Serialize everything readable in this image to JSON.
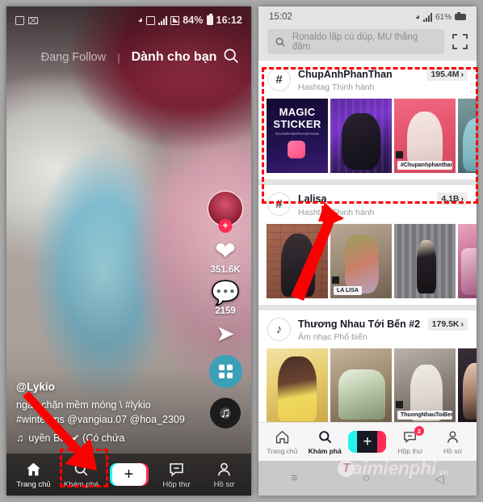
{
  "left_phone": {
    "status_bar": {
      "battery": "84%",
      "time": "16:12",
      "icons": [
        "screenshot-icon",
        "envelope-icon",
        "wifi-icon",
        "sim-icon",
        "signal-icon",
        "data-icon",
        "battery-icon"
      ]
    },
    "tabs": {
      "inactive": "Đang Follow",
      "divider": "|",
      "active": "Dành cho bạn",
      "search_icon": "search-icon"
    },
    "actions": {
      "avatar": "avatar",
      "follow_plus": "+",
      "like_count": "351.6K",
      "comment_count": "2159",
      "share_icon": "share-icon",
      "grid_icon": "grid-icon",
      "disc_icon": "music-disc-icon"
    },
    "caption": {
      "username": "@Lykio",
      "line1": "ngăn chặn mềm móng \\ #lykio",
      "line2": "#winteams @vangiau.07 @hoa_2309",
      "music": "uyền  Bảo✔ (Có chứa"
    },
    "nav": [
      {
        "label": "Trang chủ",
        "icon": "home-icon",
        "active": true
      },
      {
        "label": "Khám phá",
        "icon": "search-icon",
        "active": false
      },
      {
        "label": "",
        "icon": "plus-icon",
        "active": false
      },
      {
        "label": "Hộp thư",
        "icon": "inbox-icon",
        "active": false
      },
      {
        "label": "Hồ sơ",
        "icon": "profile-icon",
        "active": false
      }
    ]
  },
  "right_phone": {
    "status_bar": {
      "time": "15:02",
      "battery": "61%",
      "icons": [
        "wifi-icon",
        "signal-icon",
        "battery-icon"
      ]
    },
    "search": {
      "placeholder": "Ronaldo lặp cú dúp, MU thắng đậm",
      "icon": "search-icon",
      "qr_icon": "qr-scan-icon"
    },
    "feed": [
      {
        "badge": "#",
        "badge_icon": "hashtag-icon",
        "title": "ChupAnhPhanThan",
        "subtitle": "Hashtag Thịnh hành",
        "count": "195.4M",
        "chevron": "›",
        "highlighted": true,
        "thumbs": [
          {
            "art": "t-magic",
            "label": "",
            "title_big": "MAGIC",
            "title_big2": "STICKER",
            "small": "#CHUPANHPHANTHAN"
          },
          {
            "art": "t-purple",
            "label": ""
          },
          {
            "art": "t-pink",
            "label": "#Chupanhphanthan"
          },
          {
            "art": "t-teal",
            "label": "",
            "partial": true
          }
        ]
      },
      {
        "badge": "#",
        "badge_icon": "hashtag-icon",
        "title": "Lalisa",
        "subtitle": "Hashtag Thịnh hành",
        "count": "4.1B",
        "chevron": "›",
        "highlighted": false,
        "thumbs": [
          {
            "art": "t-brick",
            "label": ""
          },
          {
            "art": "t-room",
            "label": "LA LISA"
          },
          {
            "art": "t-curtain",
            "label": ""
          },
          {
            "art": "t-lisa2",
            "label": "",
            "partial": true
          }
        ]
      },
      {
        "badge": "♪",
        "badge_icon": "music-note-icon",
        "title": "Thương Nhau Tới Bến #2",
        "subtitle": "Âm nhạc Phổ biến",
        "count": "179.5K",
        "chevron": "›",
        "highlighted": false,
        "thumbs": [
          {
            "art": "t-yellow",
            "label": ""
          },
          {
            "art": "t-group",
            "label": ""
          },
          {
            "art": "t-white",
            "label": "ThuongNhauToiBen"
          },
          {
            "art": "t-dark",
            "label": "",
            "partial": true
          }
        ]
      }
    ],
    "nav": [
      {
        "label": "Trang chủ",
        "icon": "home-icon",
        "active": false,
        "badge": ""
      },
      {
        "label": "Khám phá",
        "icon": "search-icon",
        "active": true,
        "badge": ""
      },
      {
        "label": "",
        "icon": "plus-icon",
        "active": false,
        "badge": ""
      },
      {
        "label": "Hộp thư",
        "icon": "inbox-icon",
        "active": false,
        "badge": "2"
      },
      {
        "label": "Hồ sơ",
        "icon": "profile-icon",
        "active": false,
        "badge": ""
      }
    ],
    "system_nav": {
      "recents": "≡",
      "home": "○",
      "back": "◁"
    }
  },
  "watermark": {
    "logo": "T",
    "name": "aimienphi",
    "tld": ".vn"
  },
  "annotations": {
    "highlight_card": "ChupAnhPhanThan card highlighted with red dashed box",
    "highlight_nav": "Khám phá tab highlighted with red dashed box",
    "arrow_color": "#fb0000"
  }
}
